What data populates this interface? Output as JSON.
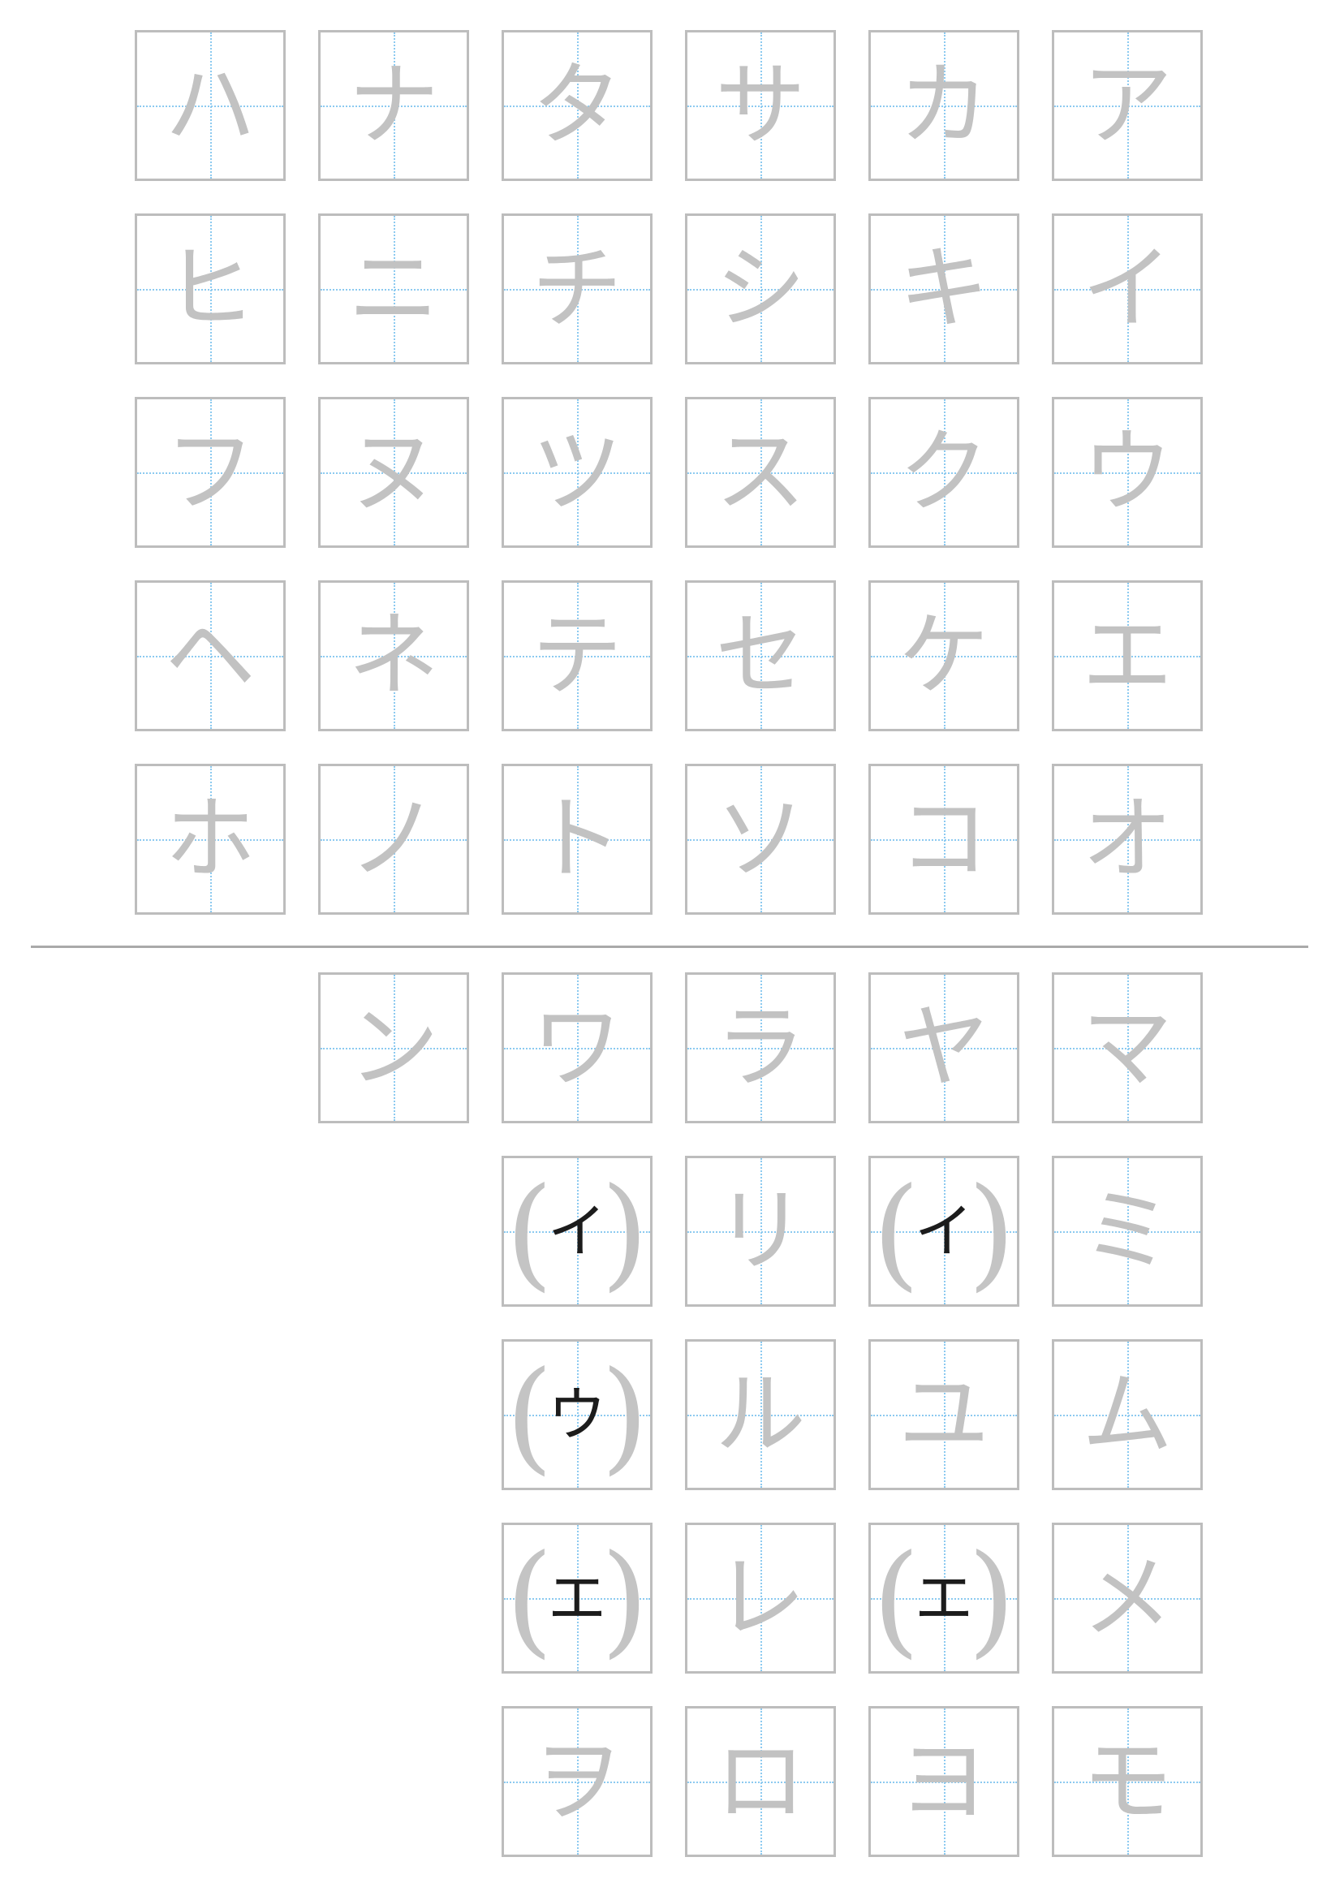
{
  "upper_section": {
    "columns": [
      [
        "ハ",
        "ヒ",
        "フ",
        "ヘ",
        "ホ"
      ],
      [
        "ナ",
        "ニ",
        "ヌ",
        "ネ",
        "ノ"
      ],
      [
        "タ",
        "チ",
        "ツ",
        "テ",
        "ト"
      ],
      [
        "サ",
        "シ",
        "ス",
        "セ",
        "ソ"
      ],
      [
        "カ",
        "キ",
        "ク",
        "ケ",
        "コ"
      ],
      [
        "ア",
        "イ",
        "ウ",
        "エ",
        "オ"
      ]
    ]
  },
  "lower_section": {
    "columns": [
      [
        {
          "char": "ン",
          "obsolete": false
        }
      ],
      [
        {
          "char": "ワ",
          "obsolete": false
        },
        {
          "char": "イ",
          "obsolete": true,
          "left_paren": "(",
          "right_paren": ")"
        },
        {
          "char": "ウ",
          "obsolete": true,
          "left_paren": "(",
          "right_paren": ")"
        },
        {
          "char": "エ",
          "obsolete": true,
          "left_paren": "(",
          "right_paren": ")"
        },
        {
          "char": "ヲ",
          "obsolete": false
        }
      ],
      [
        {
          "char": "ラ",
          "obsolete": false
        },
        {
          "char": "リ",
          "obsolete": false
        },
        {
          "char": "ル",
          "obsolete": false
        },
        {
          "char": "レ",
          "obsolete": false
        },
        {
          "char": "ロ",
          "obsolete": false
        }
      ],
      [
        {
          "char": "ヤ",
          "obsolete": false
        },
        {
          "char": "イ",
          "obsolete": true,
          "left_paren": "(",
          "right_paren": ")"
        },
        {
          "char": "ユ",
          "obsolete": false
        },
        {
          "char": "エ",
          "obsolete": true,
          "left_paren": "(",
          "right_paren": ")"
        },
        {
          "char": "ヨ",
          "obsolete": false
        }
      ],
      [
        {
          "char": "マ",
          "obsolete": false
        },
        {
          "char": "ミ",
          "obsolete": false
        },
        {
          "char": "ム",
          "obsolete": false
        },
        {
          "char": "メ",
          "obsolete": false
        },
        {
          "char": "モ",
          "obsolete": false
        }
      ]
    ]
  },
  "colors": {
    "trace_character": "#c2c2c2",
    "obsolete_character": "#1c1c1c",
    "cell_border": "#bdbdbd",
    "guide_lines": "#8ccaf0",
    "divider": "#a9a9a9"
  }
}
